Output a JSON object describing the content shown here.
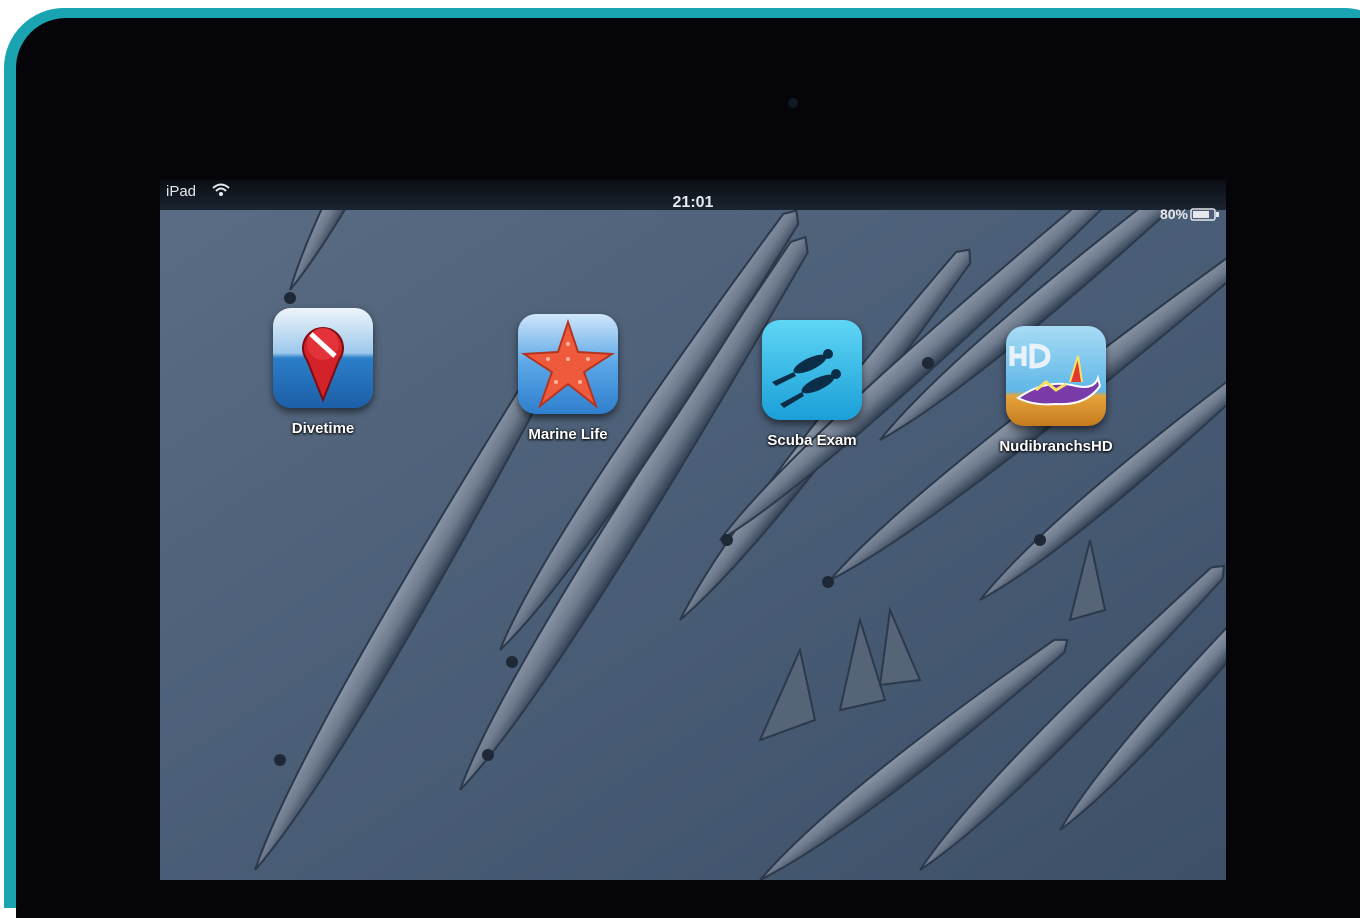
{
  "status_bar": {
    "device": "iPad",
    "time": "21:01",
    "battery": "80%",
    "battery_level": 0.8
  },
  "apps": [
    {
      "label": "Divetime",
      "icon": "map-pin-dive-flag-icon"
    },
    {
      "label": "Marine Life",
      "icon": "starfish-icon"
    },
    {
      "label": "Scuba Exam",
      "icon": "scuba-divers-icon"
    },
    {
      "label": "NudibranchsHD",
      "icon": "nudibranch-icon"
    }
  ],
  "colors": {
    "case": "#1aa3b0",
    "bezel": "#050409",
    "wallpaper": "#4d6077"
  }
}
